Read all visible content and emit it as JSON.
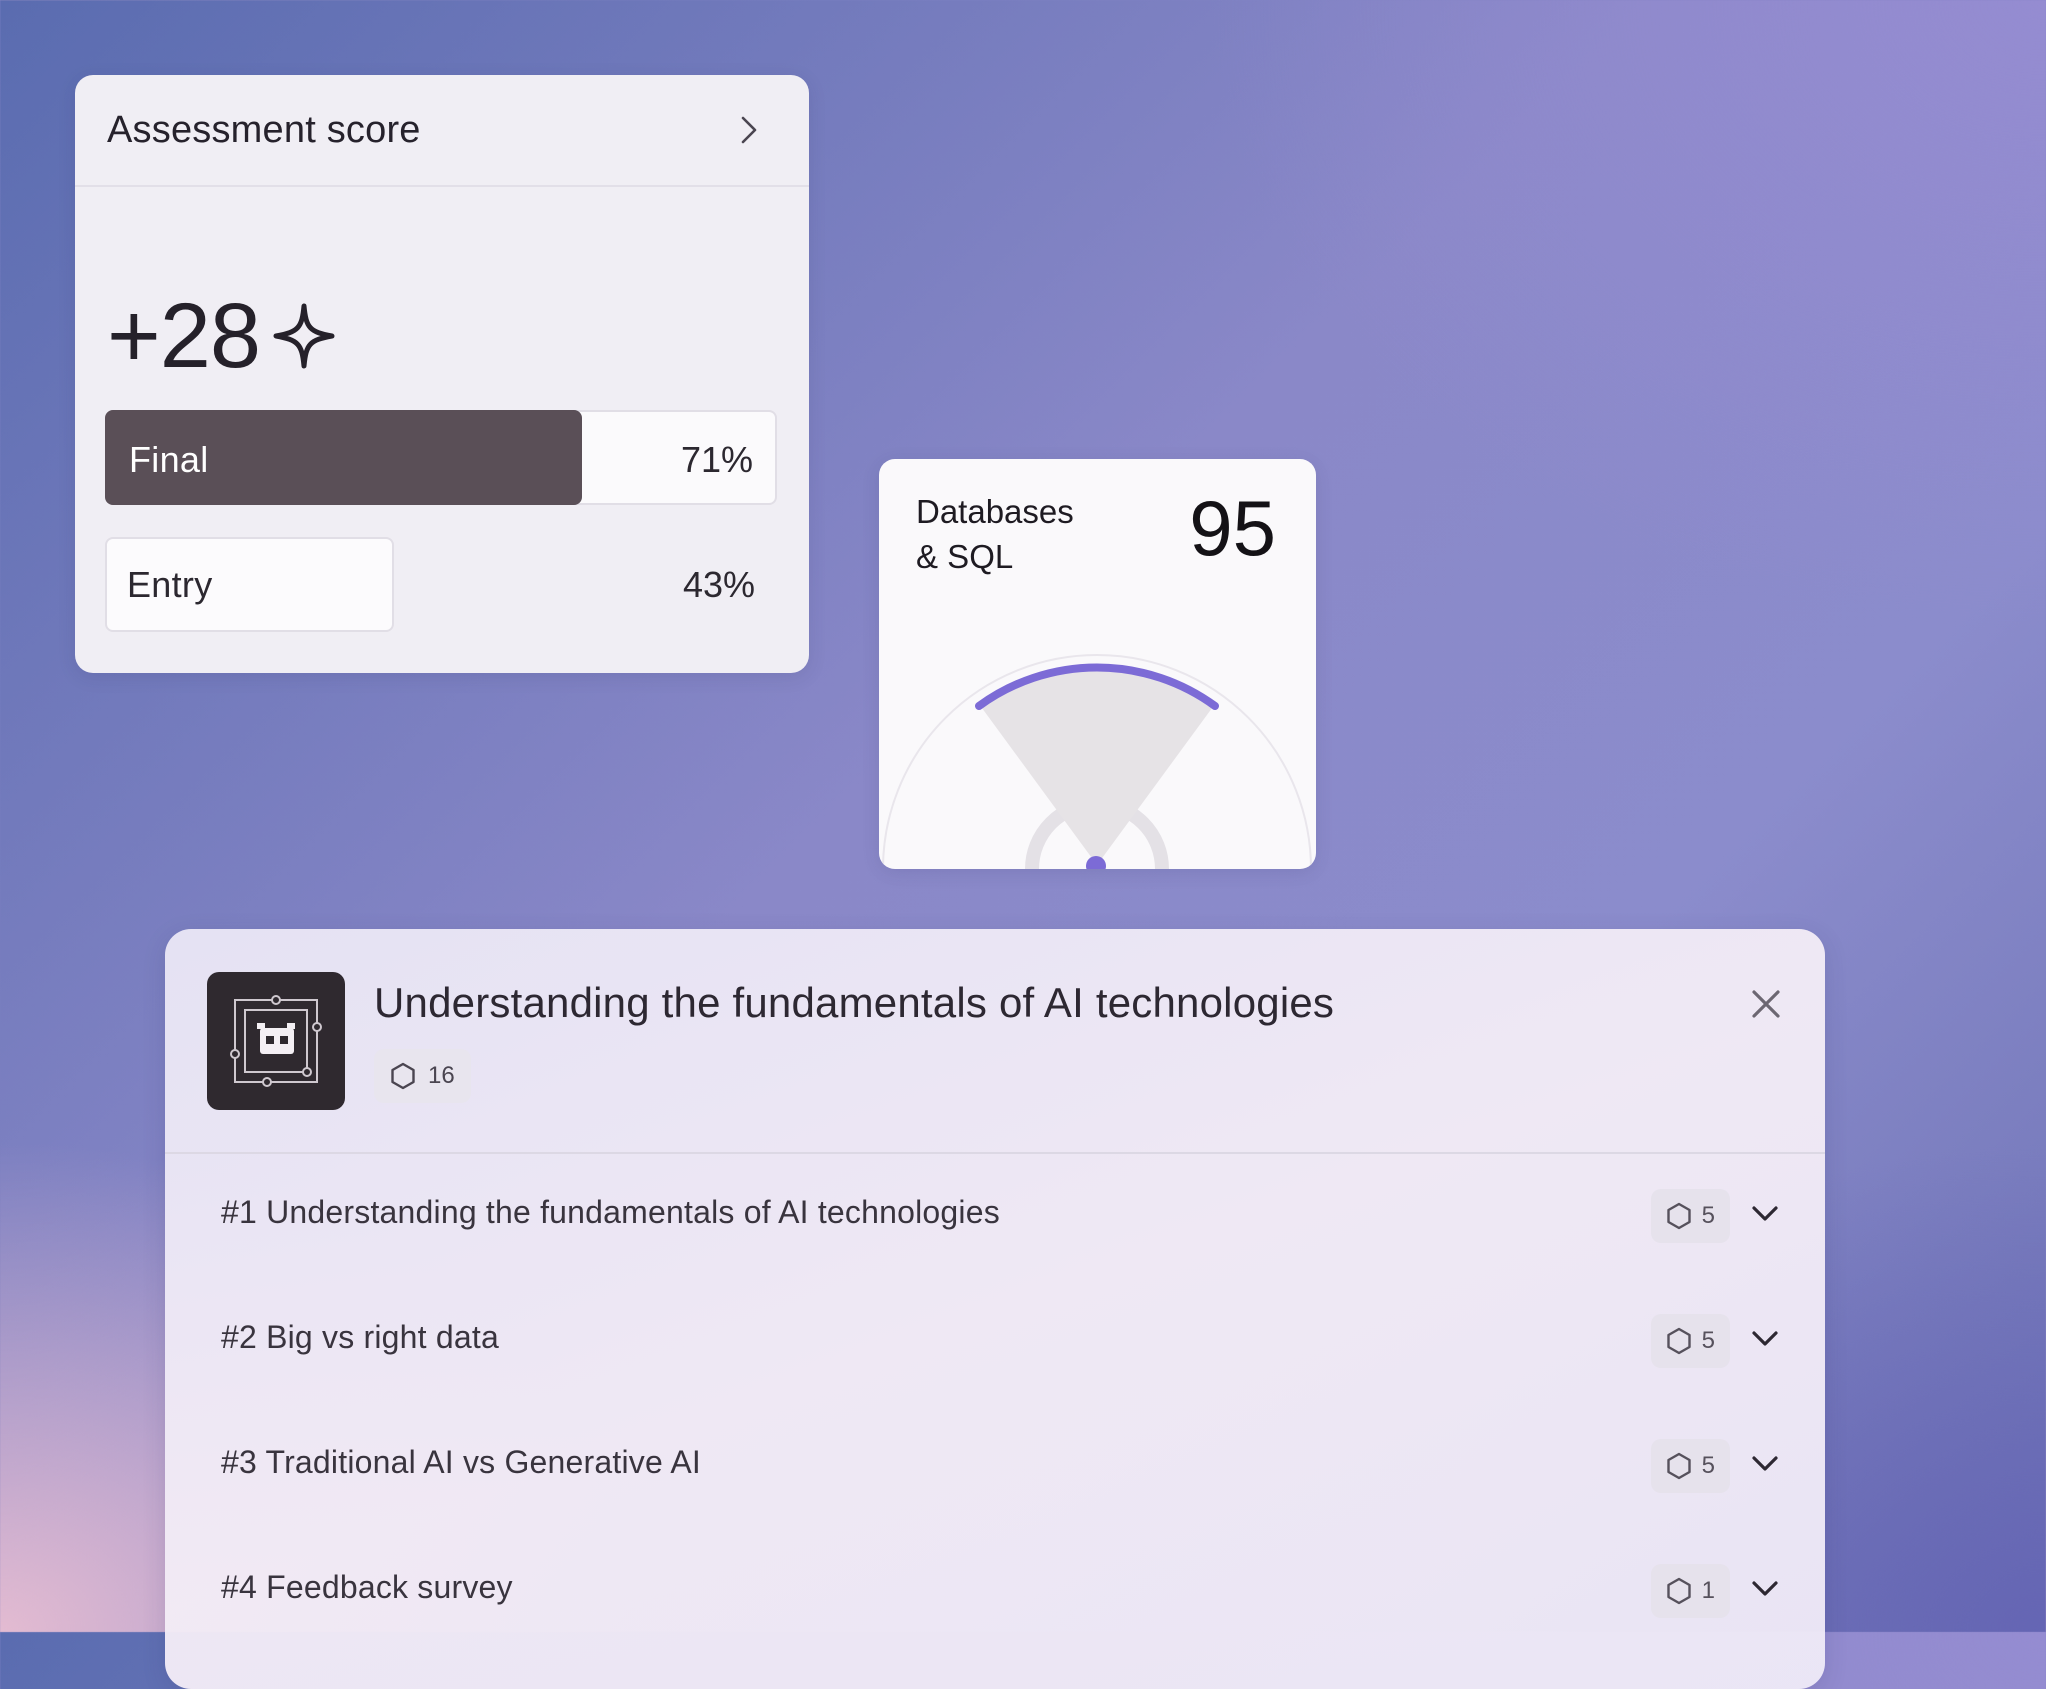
{
  "assessment": {
    "title": "Assessment score",
    "score": "+28",
    "bars": [
      {
        "label": "Final",
        "percent_text": "71%",
        "fraction": 0.71
      },
      {
        "label": "Entry",
        "percent_text": "43%",
        "fraction": 0.43
      }
    ]
  },
  "gauge": {
    "label_line1": "Databases",
    "label_line2": "& SQL",
    "value": "95",
    "accent_color": "#7c6bd6"
  },
  "course": {
    "title": "Understanding the fundamentals of AI technologies",
    "count": "16",
    "modules": [
      {
        "title": "#1 Understanding the fundamentals of AI technologies",
        "count": "5"
      },
      {
        "title": "#2 Big vs right data",
        "count": "5"
      },
      {
        "title": "#3 Traditional AI vs Generative AI",
        "count": "5"
      },
      {
        "title": "#4 Feedback survey",
        "count": "1"
      }
    ]
  },
  "icons": {
    "assessment_link": "chevron-right-icon",
    "score_decoration": "sparkle-icon",
    "course_logo": "robot-icon",
    "count": "hexagon-icon",
    "close": "close-icon",
    "expand": "chevron-down-icon"
  }
}
